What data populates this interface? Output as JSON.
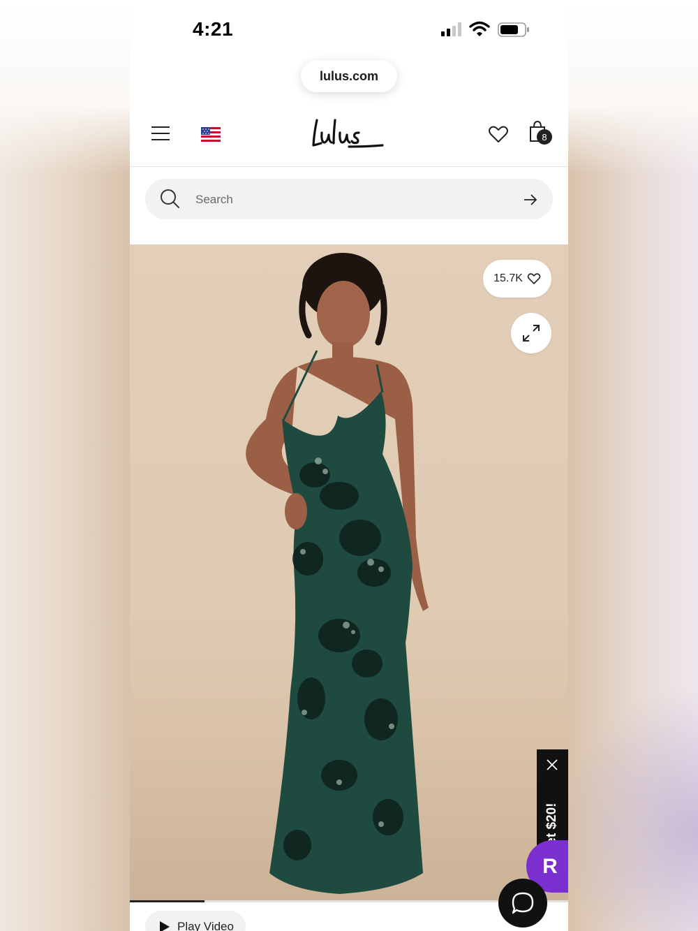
{
  "status_bar": {
    "time": "4:21",
    "signal_icon": "cellular-signal-icon",
    "wifi_icon": "wifi-icon",
    "battery_icon": "battery-icon"
  },
  "browser": {
    "url": "lulus.com"
  },
  "header": {
    "menu_icon": "hamburger-menu-icon",
    "flag_icon": "us-flag-icon",
    "logo_text": "Lulus",
    "wishlist_icon": "heart-icon",
    "bag_icon": "shopping-bag-icon",
    "bag_count": "8"
  },
  "search": {
    "placeholder": "Search",
    "value": "",
    "submit_icon": "arrow-right-icon"
  },
  "product": {
    "likes": "15.7K",
    "like_icon": "heart-outline-icon",
    "expand_icon": "expand-icon",
    "dress_color": "#1e4a3f",
    "video_progress": 0.17,
    "play_label": "Play Video"
  },
  "promo": {
    "label": "Get $20!",
    "close_icon": "close-icon",
    "rakuten_letter": "R",
    "rakuten_color": "#7b2fcf"
  },
  "chat": {
    "icon": "chat-bubble-icon"
  }
}
